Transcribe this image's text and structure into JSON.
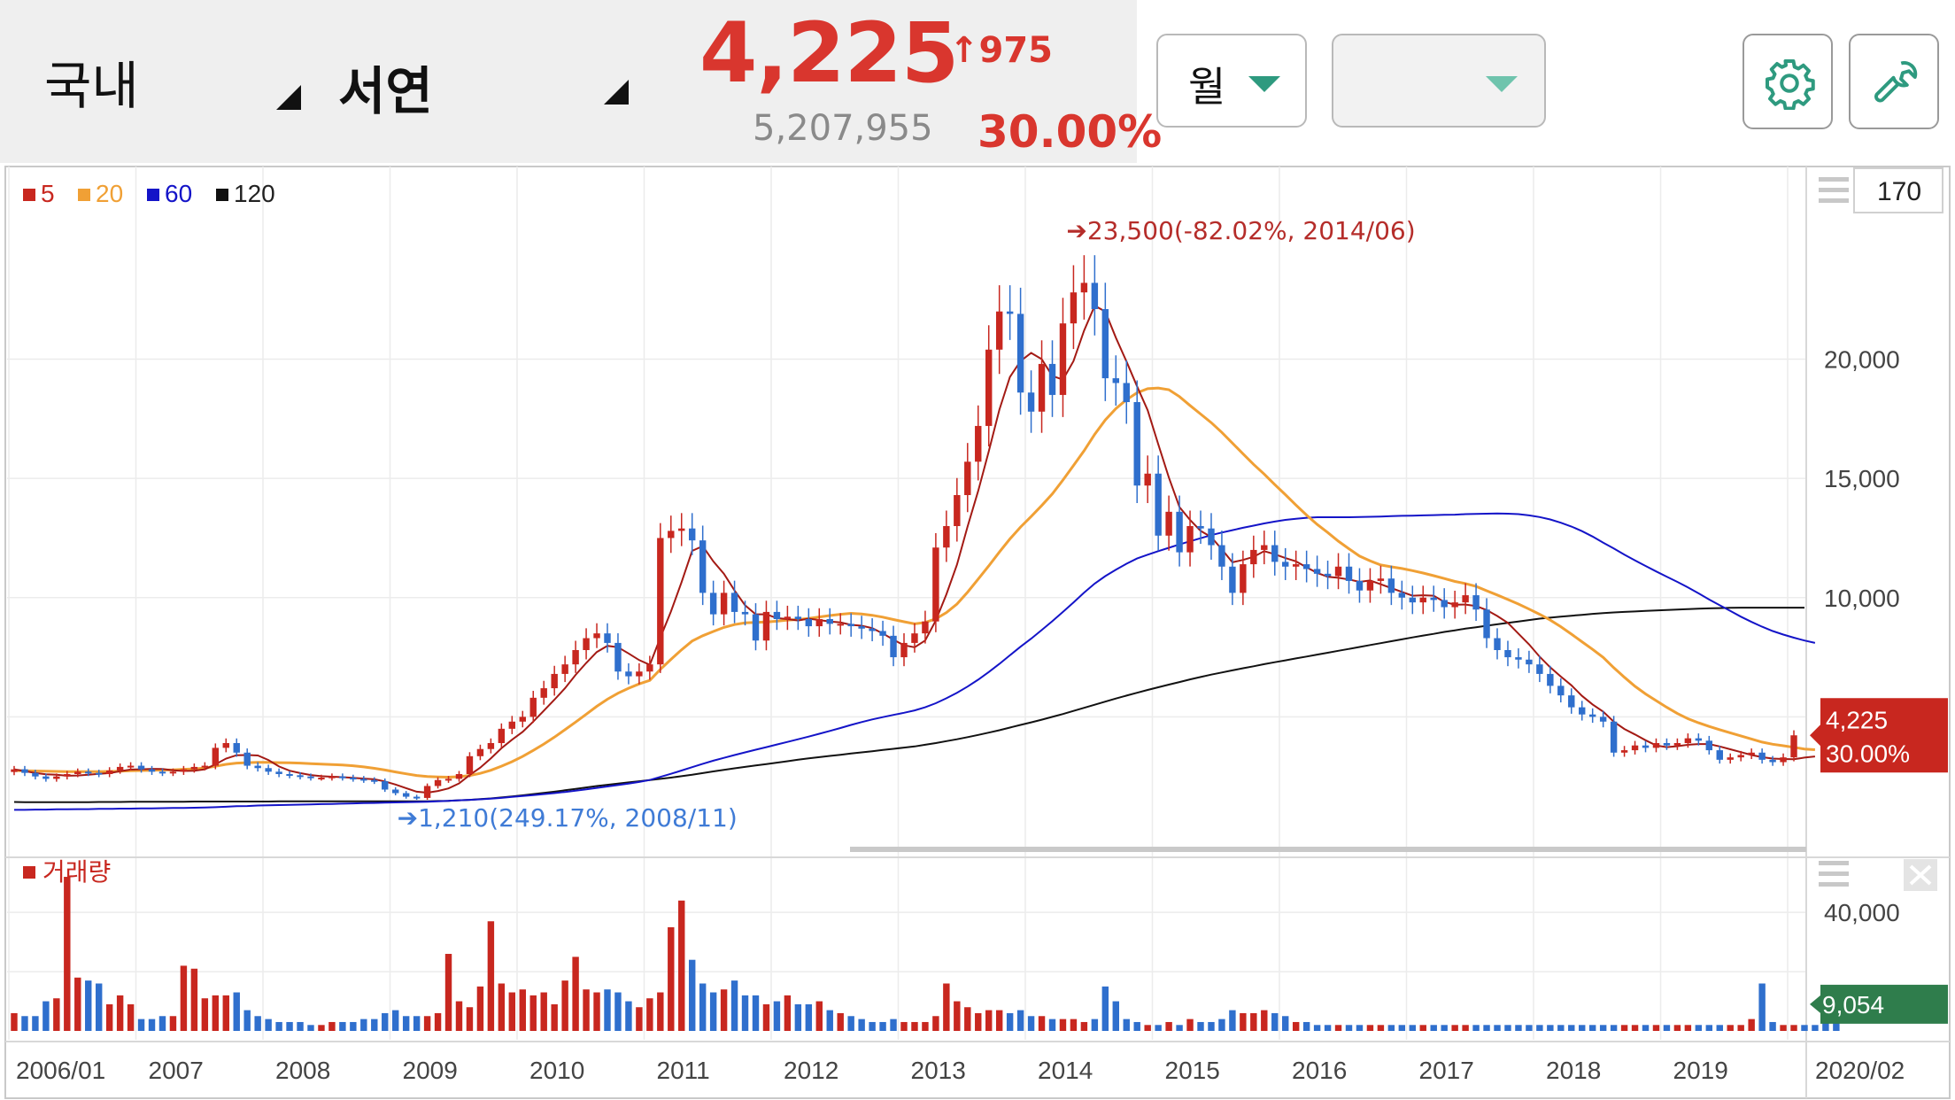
{
  "header": {
    "market": "국내",
    "stock_name": "서연",
    "price": "4,225",
    "change": "975",
    "change_arrow": "↑",
    "volume": "5,207,955",
    "change_percent": "30.00%",
    "period_selector": "월",
    "second_selector": "",
    "settings_icon": "gear-icon",
    "tools_icon": "wrench-icon"
  },
  "chart_panel": {
    "count_box": "170",
    "menu_icon": "hamburger-icon",
    "close_icon": "close-icon"
  },
  "colors": {
    "up": "#c8271f",
    "down": "#2f6fcd",
    "ma5": "#a31a14",
    "ma20": "#f0a035",
    "ma60": "#1414c8",
    "ma120": "#111111",
    "volume_badge": "#2f7d4c",
    "price_badge": "#c8271f"
  },
  "chart_data": [
    {
      "type": "candlestick",
      "legend": [
        {
          "label": "5",
          "color": "#c8271f"
        },
        {
          "label": "20",
          "color": "#f0a035"
        },
        {
          "label": "60",
          "color": "#1414c8"
        },
        {
          "label": "120",
          "color": "#111111"
        }
      ],
      "x_labels": [
        "2006/01",
        "2007",
        "2008",
        "2009",
        "2010",
        "2011",
        "2012",
        "2013",
        "2014",
        "2015",
        "2016",
        "2017",
        "2018",
        "2019",
        "2020/02"
      ],
      "y_ticks": [
        {
          "value": 10000,
          "label": "10,000"
        },
        {
          "value": 15000,
          "label": "15,000"
        },
        {
          "value": 20000,
          "label": "20,000"
        }
      ],
      "ylim": [
        0,
        26000
      ],
      "annotations": {
        "high": "23,500(-82.02%, 2014/06)",
        "low": "1,210(249.17%, 2008/11)"
      },
      "last_price": "4,225",
      "last_change": "30.00%",
      "close": [
        2800,
        2650,
        2500,
        2400,
        2500,
        2600,
        2700,
        2650,
        2600,
        2750,
        2900,
        2950,
        2800,
        2700,
        2650,
        2700,
        2800,
        2900,
        2950,
        3700,
        3900,
        3500,
        2950,
        2850,
        2700,
        2600,
        2550,
        2500,
        2450,
        2450,
        2500,
        2450,
        2400,
        2350,
        2300,
        1950,
        1800,
        1650,
        1600,
        2100,
        2350,
        2400,
        2600,
        3350,
        3650,
        3900,
        4500,
        4800,
        5000,
        5800,
        6200,
        6800,
        7200,
        7800,
        8300,
        8500,
        8100,
        6900,
        6700,
        6900,
        7200,
        12500,
        12800,
        12900,
        12400,
        10200,
        9300,
        10200,
        9400,
        9300,
        8200,
        9400,
        9100,
        9200,
        9100,
        8800,
        9100,
        8900,
        8900,
        8800,
        8700,
        8600,
        8400,
        7500,
        8100,
        8500,
        9000,
        12100,
        13000,
        14300,
        15700,
        17200,
        20400,
        22000,
        21900,
        18600,
        17800,
        19800,
        18500,
        21500,
        22800,
        23200,
        22100,
        19200,
        19000,
        18200,
        14700,
        15200,
        12600,
        13600,
        11900,
        13000,
        12900,
        12200,
        11300,
        10200,
        11400,
        12000,
        12200,
        11500,
        11300,
        11400,
        11200,
        11000,
        10900,
        11300,
        10700,
        10300,
        10700,
        10800,
        10200,
        10000,
        9800,
        10000,
        9900,
        9600,
        9800,
        10100,
        9500,
        8300,
        7800,
        7500,
        7400,
        7200,
        6800,
        6300,
        5900,
        5400,
        5100,
        5000,
        4800,
        3500,
        3600,
        3800,
        3700,
        3900,
        3800,
        3900,
        4100,
        4000,
        3600,
        3200,
        3300,
        3400,
        3500,
        3200,
        3100,
        3300,
        4225
      ],
      "ma_series": {
        "ma5": [
          2800,
          2725,
          2650,
          2588,
          2570,
          2530,
          2540,
          2570,
          2610,
          2640,
          2720,
          2790,
          2800,
          2820,
          2810,
          2760,
          2730,
          2740,
          2800,
          3010,
          3250,
          3390,
          3400,
          3380,
          3190,
          2920,
          2740,
          2640,
          2560,
          2510,
          2490,
          2470,
          2440,
          2410,
          2380,
          2290,
          2160,
          2010,
          1860,
          1820,
          1890,
          2000,
          2210,
          2560,
          2870,
          3260,
          3680,
          4040,
          4370,
          4800,
          5260,
          5720,
          6200,
          6760,
          7260,
          7720,
          7980,
          7920,
          7660,
          7380,
          7180,
          8320,
          9420,
          10640,
          11960,
          12160,
          11520,
          11000,
          10300,
          9680,
          9300,
          9300,
          9140,
          9100,
          9040,
          9120,
          9060,
          9000,
          8960,
          8860,
          8820,
          8720,
          8500,
          8240,
          8000,
          7920,
          8200,
          9040,
          10140,
          11380,
          12980,
          14480,
          16130,
          17880,
          19250,
          19920,
          20260,
          20000,
          19300,
          19140,
          19920,
          21200,
          22240,
          22000,
          20900,
          19900,
          18860,
          17860,
          16440,
          15040,
          13800,
          13260,
          12800,
          12540,
          12030,
          11480,
          11580,
          11710,
          11950,
          11820,
          11660,
          11520,
          11270,
          11040,
          10870,
          10830,
          10760,
          10660,
          10720,
          10560,
          10400,
          10240,
          10080,
          10100,
          10080,
          9820,
          9700,
          9710,
          9650,
          9480,
          9230,
          8940,
          8490,
          8040,
          7520,
          7080,
          6690,
          6320,
          5880,
          5520,
          5220,
          4800,
          4490,
          4260,
          4020,
          3800,
          3730,
          3770,
          3830,
          3860,
          3860,
          3760,
          3640,
          3520,
          3400,
          3310,
          3250,
          3230,
          3220,
          3290,
          3340
        ],
        "ma20": [
          2750,
          2740,
          2730,
          2720,
          2710,
          2700,
          2700,
          2700,
          2700,
          2710,
          2720,
          2740,
          2750,
          2760,
          2770,
          2780,
          2800,
          2820,
          2850,
          2930,
          3010,
          3060,
          3080,
          3090,
          3090,
          3080,
          3070,
          3060,
          3040,
          3020,
          3000,
          2980,
          2950,
          2900,
          2840,
          2770,
          2690,
          2610,
          2540,
          2500,
          2480,
          2470,
          2490,
          2540,
          2630,
          2760,
          2930,
          3120,
          3340,
          3590,
          3860,
          4150,
          4460,
          4780,
          5110,
          5440,
          5740,
          5990,
          6200,
          6380,
          6530,
          6990,
          7410,
          7810,
          8180,
          8400,
          8580,
          8750,
          8870,
          8940,
          8960,
          8980,
          9010,
          9060,
          9080,
          9130,
          9190,
          9250,
          9300,
          9340,
          9310,
          9260,
          9180,
          9080,
          8990,
          8900,
          8960,
          9110,
          9370,
          9730,
          10230,
          10780,
          11330,
          11910,
          12460,
          12960,
          13400,
          13860,
          14350,
          14930,
          15540,
          16160,
          16850,
          17450,
          17930,
          18300,
          18590,
          18760,
          18790,
          18720,
          18430,
          18060,
          17700,
          17340,
          16930,
          16480,
          16030,
          15590,
          15180,
          14740,
          14320,
          13880,
          13460,
          13070,
          12730,
          12370,
          12050,
          11740,
          11540,
          11370,
          11290,
          11220,
          11130,
          11030,
          10920,
          10800,
          10680,
          10590,
          10470,
          10290,
          10110,
          9920,
          9730,
          9520,
          9300,
          9060,
          8780,
          8470,
          8150,
          7830,
          7490,
          7060,
          6660,
          6280,
          5960,
          5680,
          5400,
          5140,
          4920,
          4750,
          4600,
          4460,
          4330,
          4200,
          4070,
          3940,
          3850,
          3790,
          3720,
          3650,
          3620
        ],
        "ma60": [
          1100,
          1100,
          1110,
          1110,
          1120,
          1120,
          1130,
          1130,
          1140,
          1140,
          1150,
          1150,
          1160,
          1160,
          1170,
          1180,
          1180,
          1190,
          1200,
          1210,
          1230,
          1250,
          1260,
          1280,
          1290,
          1300,
          1310,
          1320,
          1330,
          1340,
          1350,
          1360,
          1370,
          1380,
          1390,
          1400,
          1410,
          1420,
          1430,
          1440,
          1460,
          1480,
          1500,
          1520,
          1540,
          1570,
          1600,
          1640,
          1680,
          1720,
          1760,
          1800,
          1850,
          1900,
          1960,
          2020,
          2080,
          2140,
          2200,
          2270,
          2350,
          2480,
          2610,
          2750,
          2890,
          3030,
          3160,
          3280,
          3400,
          3510,
          3620,
          3730,
          3840,
          3950,
          4060,
          4170,
          4290,
          4410,
          4530,
          4660,
          4780,
          4890,
          4990,
          5080,
          5170,
          5270,
          5400,
          5570,
          5780,
          6010,
          6270,
          6560,
          6880,
          7220,
          7580,
          7940,
          8280,
          8640,
          9010,
          9400,
          9800,
          10210,
          10590,
          10900,
          11170,
          11420,
          11640,
          11800,
          11950,
          12090,
          12230,
          12360,
          12490,
          12620,
          12730,
          12830,
          12930,
          13020,
          13110,
          13190,
          13260,
          13310,
          13350,
          13370,
          13370,
          13370,
          13370,
          13380,
          13390,
          13400,
          13420,
          13430,
          13440,
          13450,
          13460,
          13470,
          13480,
          13500,
          13510,
          13520,
          13530,
          13520,
          13500,
          13450,
          13380,
          13280,
          13140,
          12980,
          12790,
          12560,
          12300,
          12060,
          11800,
          11560,
          11330,
          11100,
          10880,
          10660,
          10430,
          10180,
          9920,
          9680,
          9440,
          9200,
          8980,
          8780,
          8600,
          8450,
          8320,
          8200,
          8100
        ],
        "ma120": [
          1430,
          1420,
          1420,
          1420,
          1420,
          1420,
          1420,
          1420,
          1430,
          1430,
          1430,
          1440,
          1440,
          1440,
          1440,
          1440,
          1440,
          1450,
          1450,
          1450,
          1450,
          1450,
          1450,
          1450,
          1450,
          1460,
          1460,
          1460,
          1460,
          1460,
          1460,
          1460,
          1460,
          1460,
          1460,
          1460,
          1460,
          1460,
          1460,
          1460,
          1470,
          1480,
          1500,
          1520,
          1550,
          1580,
          1620,
          1660,
          1710,
          1760,
          1810,
          1860,
          1920,
          1980,
          2040,
          2100,
          2150,
          2200,
          2250,
          2300,
          2350,
          2400,
          2450,
          2510,
          2570,
          2640,
          2710,
          2780,
          2840,
          2900,
          2960,
          3020,
          3080,
          3140,
          3200,
          3260,
          3310,
          3360,
          3410,
          3460,
          3510,
          3560,
          3610,
          3660,
          3710,
          3760,
          3830,
          3900,
          3980,
          4060,
          4150,
          4240,
          4340,
          4440,
          4550,
          4660,
          4770,
          4880,
          5000,
          5120,
          5250,
          5380,
          5510,
          5640,
          5770,
          5890,
          6010,
          6130,
          6240,
          6350,
          6460,
          6570,
          6670,
          6770,
          6860,
          6950,
          7040,
          7120,
          7210,
          7290,
          7370,
          7450,
          7530,
          7610,
          7690,
          7770,
          7850,
          7930,
          8010,
          8090,
          8170,
          8250,
          8330,
          8410,
          8480,
          8560,
          8630,
          8700,
          8760,
          8820,
          8880,
          8940,
          9000,
          9060,
          9120,
          9160,
          9200,
          9240,
          9280,
          9320,
          9350,
          9380,
          9400,
          9420,
          9440,
          9460,
          9480,
          9500,
          9520,
          9540,
          9550,
          9560,
          9570,
          9580,
          9580,
          9580,
          9580,
          9580,
          9580,
          9580
        ]
      }
    },
    {
      "type": "bar",
      "legend": [
        {
          "label": "거래량",
          "color": "#c8271f"
        }
      ],
      "y_ticks": [
        {
          "value": 40000,
          "label": "40,000"
        }
      ],
      "ylim": [
        0,
        55000
      ],
      "last_volume": "9,054",
      "values": [
        6000,
        5000,
        5000,
        10000,
        11000,
        52000,
        18000,
        17000,
        16000,
        9000,
        12000,
        9000,
        4000,
        4000,
        5000,
        5000,
        22000,
        21000,
        11000,
        12000,
        12000,
        13000,
        7000,
        5000,
        4000,
        3000,
        3000,
        3000,
        2000,
        2000,
        3000,
        3000,
        3000,
        4000,
        4000,
        6000,
        7000,
        5000,
        5000,
        5000,
        6000,
        26000,
        10000,
        8000,
        15000,
        37000,
        16000,
        13000,
        14000,
        12000,
        13000,
        9000,
        17000,
        25000,
        14000,
        13000,
        14000,
        13000,
        10000,
        8000,
        11000,
        13000,
        35000,
        44000,
        24000,
        16000,
        13000,
        14000,
        17000,
        12000,
        12000,
        9000,
        10000,
        12000,
        9000,
        9000,
        10000,
        7000,
        6000,
        5000,
        4000,
        3000,
        3000,
        4000,
        3000,
        3000,
        3000,
        5000,
        16000,
        10000,
        8000,
        6000,
        7000,
        7000,
        6000,
        7000,
        5000,
        5000,
        4000,
        4000,
        4000,
        3000,
        4000,
        15000,
        10000,
        4000,
        3000,
        2000,
        2000,
        3000,
        2000,
        4000,
        3000,
        3000,
        4000,
        7000,
        6000,
        6000,
        7000,
        6000,
        5000,
        3000,
        3000,
        2000,
        2000,
        2000,
        2000,
        2000,
        2000,
        2000,
        2000,
        2000,
        2000,
        2000,
        2000,
        2000,
        2000,
        2000,
        2000,
        2000,
        2000,
        2000,
        2000,
        2000,
        2000,
        2000,
        2000,
        2000,
        2000,
        2000,
        2000,
        2000,
        2000,
        2000,
        2000,
        2000,
        2000,
        2000,
        2000,
        2000,
        2000,
        2000,
        2000,
        2000,
        4000,
        16000,
        3000,
        2000,
        2000,
        2000,
        2000,
        11000,
        9000
      ]
    }
  ]
}
